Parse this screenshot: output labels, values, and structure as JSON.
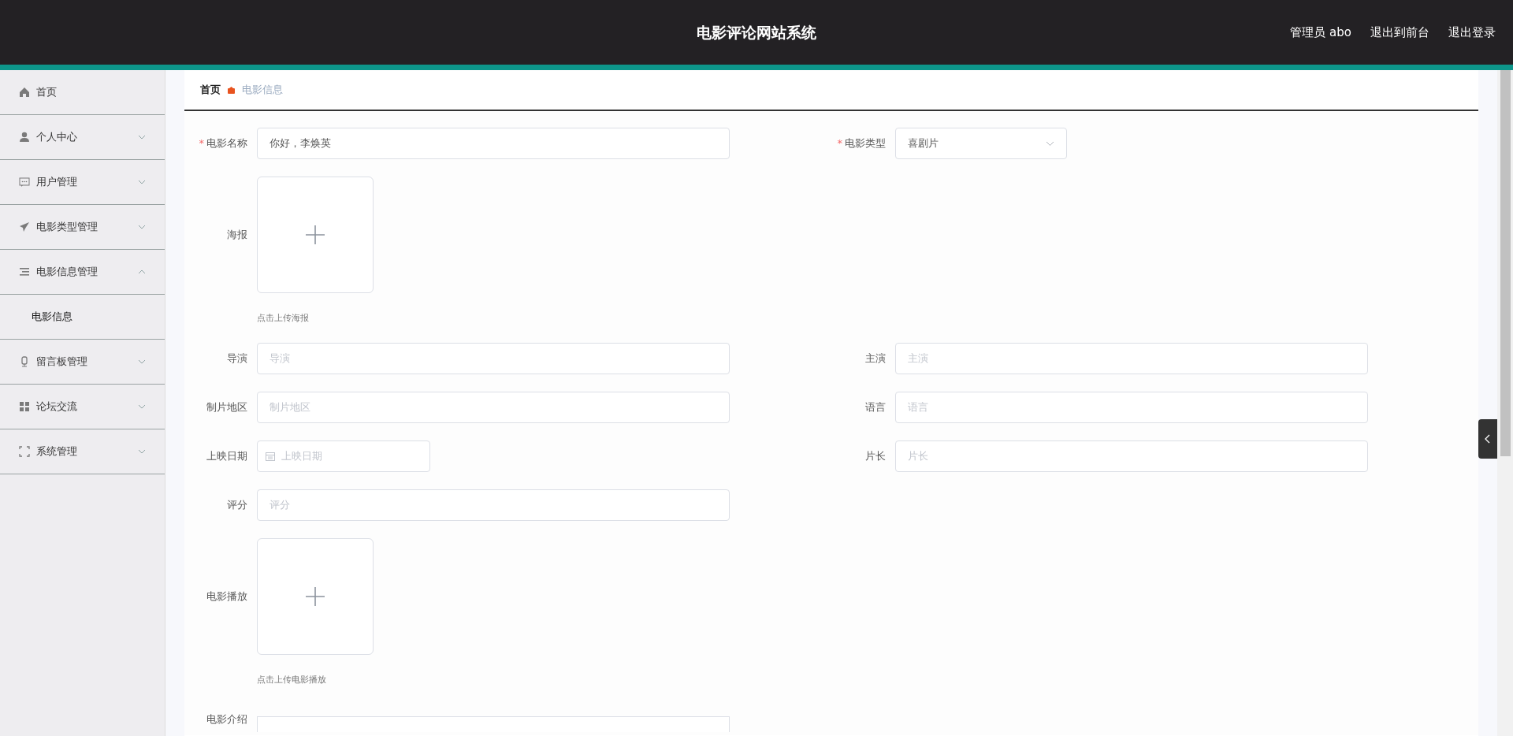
{
  "header": {
    "title": "电影评论网站系统",
    "links": [
      "管理员 abo",
      "退出到前台",
      "退出登录"
    ]
  },
  "sidebar": {
    "items": [
      {
        "label": "首页"
      },
      {
        "label": "个人中心",
        "expanded": false
      },
      {
        "label": "用户管理",
        "expanded": false
      },
      {
        "label": "电影类型管理",
        "expanded": false
      },
      {
        "label": "电影信息管理",
        "expanded": true,
        "children": [
          {
            "label": "电影信息"
          }
        ]
      },
      {
        "label": "留言板管理",
        "expanded": false
      },
      {
        "label": "论坛交流",
        "expanded": false
      },
      {
        "label": "系统管理",
        "expanded": false
      }
    ]
  },
  "breadcrumb": [
    "首页",
    "电影信息"
  ],
  "form": {
    "rows": [
      [
        {
          "kind": "text",
          "label": "电影名称",
          "required_mark": "*",
          "value": "你好，李焕英"
        },
        {
          "kind": "select",
          "label": "电影类型",
          "required_mark": "*",
          "value": "喜剧片"
        }
      ],
      [
        {
          "kind": "upload",
          "label": "海报",
          "hint": "点击上传海报"
        }
      ],
      [
        {
          "kind": "text",
          "label": "导演",
          "placeholder": "导演"
        },
        {
          "kind": "text",
          "label": "主演",
          "placeholder": "主演"
        }
      ],
      [
        {
          "kind": "text",
          "label": "制片地区",
          "placeholder": "制片地区"
        },
        {
          "kind": "text",
          "label": "语言",
          "placeholder": "语言"
        }
      ],
      [
        {
          "kind": "date",
          "label": "上映日期",
          "placeholder": "上映日期"
        },
        {
          "kind": "text",
          "label": "片长",
          "placeholder": "片长"
        }
      ],
      [
        {
          "kind": "text",
          "label": "评分",
          "placeholder": "评分"
        }
      ],
      [
        {
          "kind": "upload",
          "label": "电影播放",
          "hint": "点击上传电影播放"
        }
      ],
      [
        {
          "kind": "editor",
          "label": "电影介绍"
        }
      ]
    ]
  }
}
